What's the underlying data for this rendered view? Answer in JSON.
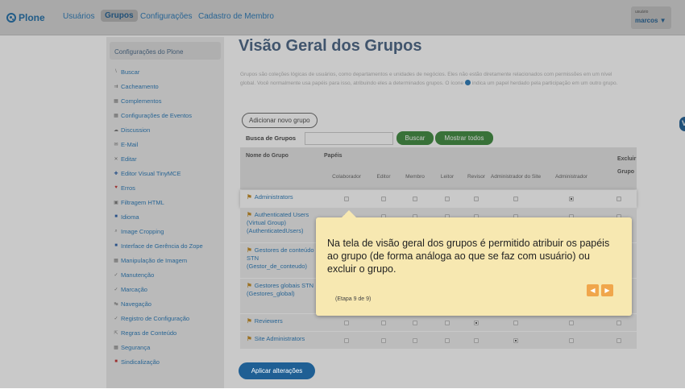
{
  "topbar": {
    "logo": "Plone",
    "nav": [
      "Usuários",
      "Grupos",
      "Configurações",
      "Cadastro de Membro"
    ],
    "user_label_small": "usuário",
    "user_name": "marcos ▼",
    "side_tab": "V"
  },
  "sidebar": {
    "header": "Configurações do Plone",
    "items": [
      {
        "label": "Buscar",
        "icon": "\\"
      },
      {
        "label": "Cacheamento",
        "icon": "⇉"
      },
      {
        "label": "Complementos",
        "icon": "▦"
      },
      {
        "label": "Configurações de Eventos",
        "icon": "▦"
      },
      {
        "label": "Discussion",
        "icon": "☁"
      },
      {
        "label": "E-Mail",
        "icon": "✉"
      },
      {
        "label": "Editar",
        "icon": "✕"
      },
      {
        "label": "Editor Visual TinyMCE",
        "icon": "✚"
      },
      {
        "label": "Erros",
        "icon": "♥"
      },
      {
        "label": "Filtragem HTML",
        "icon": "▣"
      },
      {
        "label": "Idioma",
        "icon": "■"
      },
      {
        "label": "Image Cropping",
        "icon": "⌕"
      },
      {
        "label": "Interface de Gerência do Zope",
        "icon": "■"
      },
      {
        "label": "Manipulação de Imagem",
        "icon": "▦"
      },
      {
        "label": "Manutenção",
        "icon": "✓"
      },
      {
        "label": "Marcação",
        "icon": "✓"
      },
      {
        "label": "Navegação",
        "icon": "↹"
      },
      {
        "label": "Registro de Configuração",
        "icon": "✓"
      },
      {
        "label": "Regras de Conteúdo",
        "icon": "⇱"
      },
      {
        "label": "Segurança",
        "icon": "▦"
      },
      {
        "label": "Sindicalização",
        "icon": "■"
      }
    ]
  },
  "main": {
    "title": "Visão Geral dos Grupos",
    "description_1": "Grupos são coleções lógicas de usuários, como departamentos e unidades de negócios. Eles não estão diretamente relacionados com permissões em um nível global. Você normalmente usa papéis para isso, atribuindo eles a determinados grupos. O ícone",
    "description_2": "indica um papel herdado pela participação em um outro grupo.",
    "add_group": "Adicionar novo grupo",
    "search_label": "Busca de Grupos",
    "search_btn": "Buscar",
    "show_all_btn": "Mostrar todos",
    "col_name": "Nome do Grupo",
    "col_roles": "Papéis",
    "col_delete": "Excluir Grupo",
    "role_cols": [
      "Colaborador",
      "Editor",
      "Membro",
      "Leitor",
      "Revisor",
      "Administrador do Site",
      "Administrador"
    ],
    "rows": [
      {
        "name": "Administrators",
        "checks": [
          0,
          0,
          0,
          0,
          0,
          0,
          1,
          0
        ]
      },
      {
        "name": "Authenticated Users (Virtual Group) (AuthenticatedUsers)",
        "checks": [
          0,
          0,
          0,
          0,
          0,
          0,
          0,
          0
        ]
      },
      {
        "name": "Gestores de conteúdo STN (Gestor_de_conteudo)",
        "checks": [
          0,
          0,
          0,
          0,
          0,
          0,
          0,
          0
        ]
      },
      {
        "name": "Gestores globais STN (Gestores_global)",
        "checks": [
          0,
          0,
          0,
          0,
          0,
          0,
          0,
          0
        ]
      },
      {
        "name": "Reviewers",
        "checks": [
          0,
          0,
          0,
          0,
          1,
          0,
          0,
          0
        ]
      },
      {
        "name": "Site Administrators",
        "checks": [
          0,
          0,
          0,
          0,
          0,
          1,
          0,
          0
        ]
      }
    ],
    "apply_btn": "Aplicar alterações"
  },
  "tooltip": {
    "text": "Na tela de visão geral dos grupos é permitido atribuir os papéis ao grupo (de forma análoga ao que se faz com usuário) ou excluir o grupo.",
    "step": "(Etapa 9 de 9)",
    "prev": "◀",
    "next": "▶"
  },
  "colors": {
    "accent": "#1f5f94",
    "green": "#3e8a3e",
    "tooltip_bg": "#f7e8b1",
    "tooltip_btn": "#f0a64b"
  }
}
